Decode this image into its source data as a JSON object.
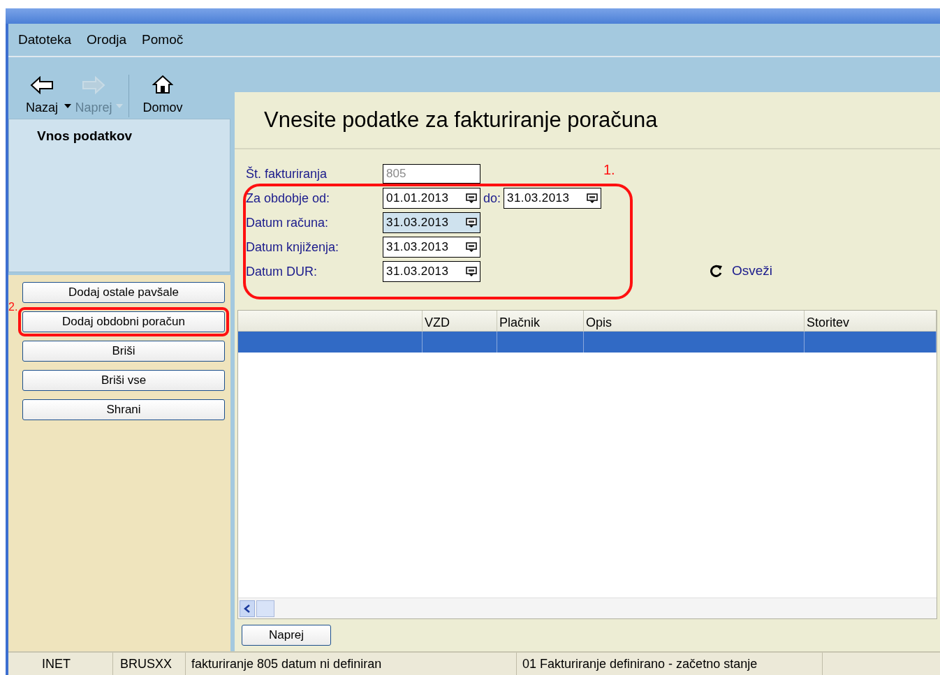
{
  "menu": [
    {
      "label": "Datoteka"
    },
    {
      "label": "Orodja"
    },
    {
      "label": "Pomoč"
    }
  ],
  "toolbar": [
    {
      "label": "Nazaj",
      "kind": "back",
      "disabled": false,
      "dropdown": true
    },
    {
      "label": "Naprej",
      "kind": "forward",
      "disabled": true,
      "dropdown": true
    },
    {
      "label": "Domov",
      "kind": "home",
      "disabled": false,
      "dropdown": false
    }
  ],
  "sidebar": {
    "title": "Vnos podatkov",
    "buttons": [
      {
        "label": "Dodaj ostale pavšale",
        "highlighted": false
      },
      {
        "label": "Dodaj obdobni poračun",
        "highlighted": true
      },
      {
        "label": "Briši",
        "highlighted": false
      },
      {
        "label": "Briši vse",
        "highlighted": false
      },
      {
        "label": "Shrani",
        "highlighted": false
      }
    ]
  },
  "heading": "Vnesite podatke za fakturiranje poračuna",
  "form": {
    "number": {
      "label": "Št. fakturiranja",
      "value": "805",
      "disabled": true
    },
    "dates": [
      {
        "label": "Za obdobje od:",
        "value": "01.01.2013",
        "focused": false,
        "to_label": "do:",
        "to_value": "31.03.2013"
      },
      {
        "label": "Datum računa:",
        "value": "31.03.2013",
        "focused": true
      },
      {
        "label": "Datum knjiženja:",
        "value": "31.03.2013",
        "focused": false
      },
      {
        "label": "Datum DUR:",
        "value": "31.03.2013",
        "focused": false
      }
    ],
    "refresh": "Osveži"
  },
  "annotations": [
    "1.",
    "2."
  ],
  "table": {
    "columns": [
      "",
      "VZD",
      "Plačnik",
      "Opis",
      "Storitev"
    ],
    "rows": [
      {
        "selected": true
      }
    ]
  },
  "next_button": "Naprej",
  "status_bar": [
    "INET",
    "BRUSXX",
    "fakturiranje 805  datum ni definiran",
    "01 Fakturiranje definirano - začetno stanje"
  ]
}
